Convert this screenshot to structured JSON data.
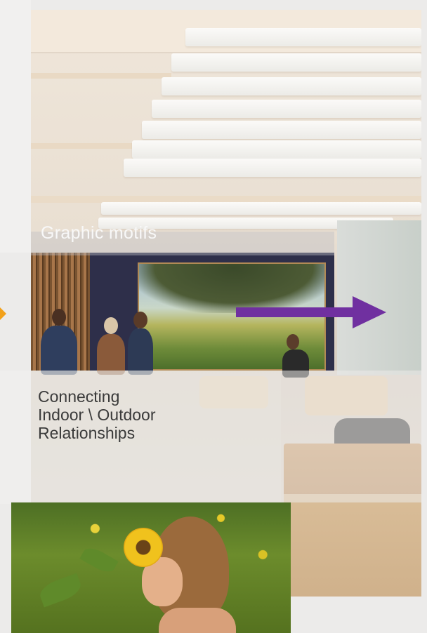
{
  "slide": {
    "title": "Graphic motifs",
    "caption_lines": [
      "Connecting",
      "Indoor \\ Outdoor",
      "Relationships"
    ]
  },
  "colors": {
    "accent_purple": "#7030a0",
    "accent_orange": "#f2a11b",
    "background": "#ecebea"
  },
  "images": {
    "main": "interior-photo",
    "secondary": "sunflower-photo"
  }
}
